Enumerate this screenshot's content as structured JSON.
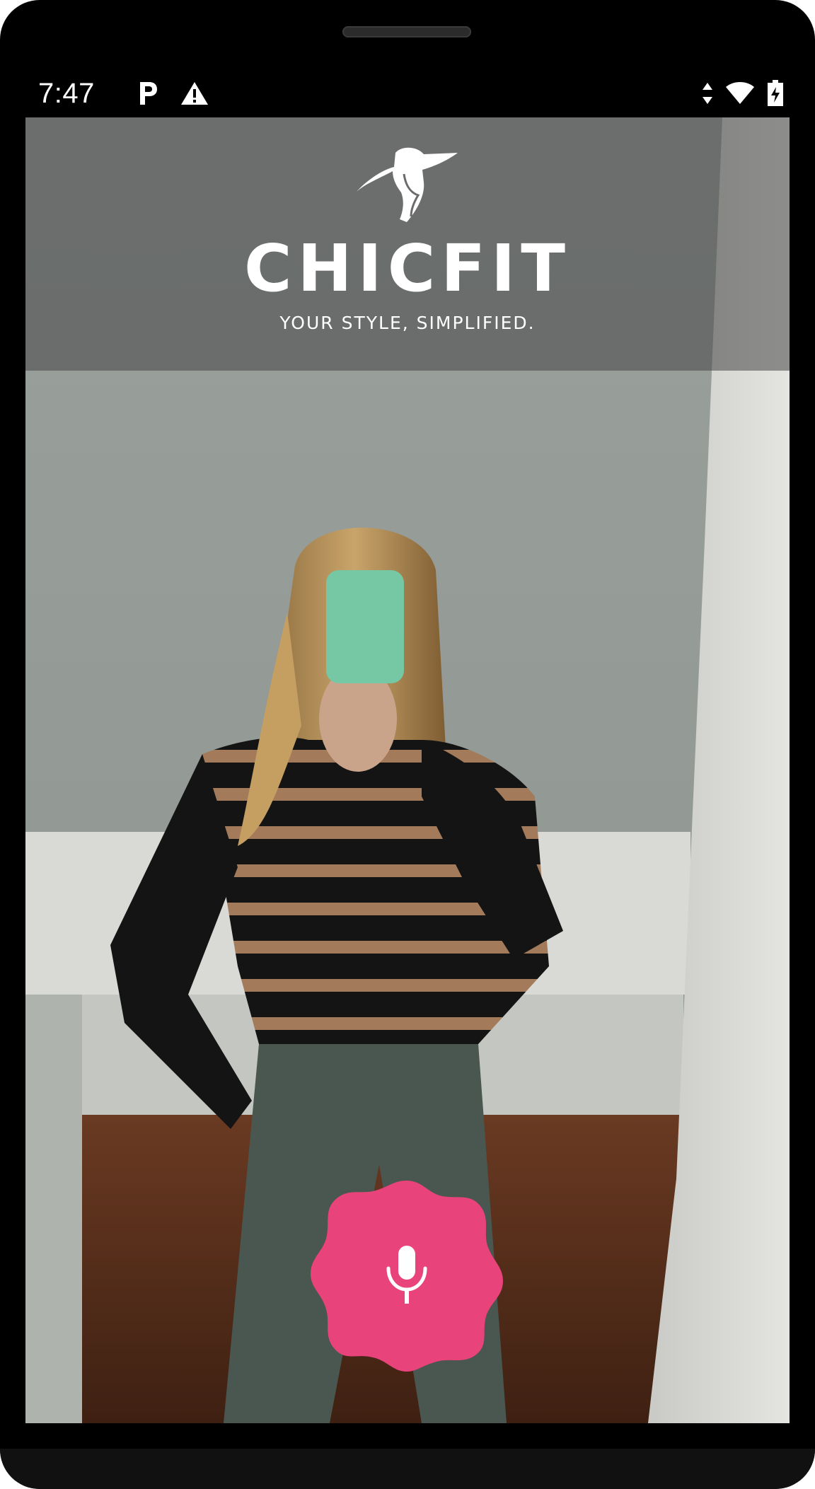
{
  "status_bar": {
    "time": "7:47",
    "left_icons": [
      "parking-icon",
      "warning-icon"
    ],
    "right_icons": [
      "data-arrows-icon",
      "wifi-icon",
      "battery-charging-icon"
    ]
  },
  "brand": {
    "name": "CHICFIT",
    "tagline": "YOUR STYLE, SIMPLIFIED.",
    "logo_icon": "woman-hat-logo-icon"
  },
  "camera": {
    "description_icon": "camera-preview"
  },
  "mic_button": {
    "icon": "microphone-icon",
    "color": "#e8437a"
  },
  "colors": {
    "accent": "#e8437a",
    "device_frame": "#000000"
  }
}
